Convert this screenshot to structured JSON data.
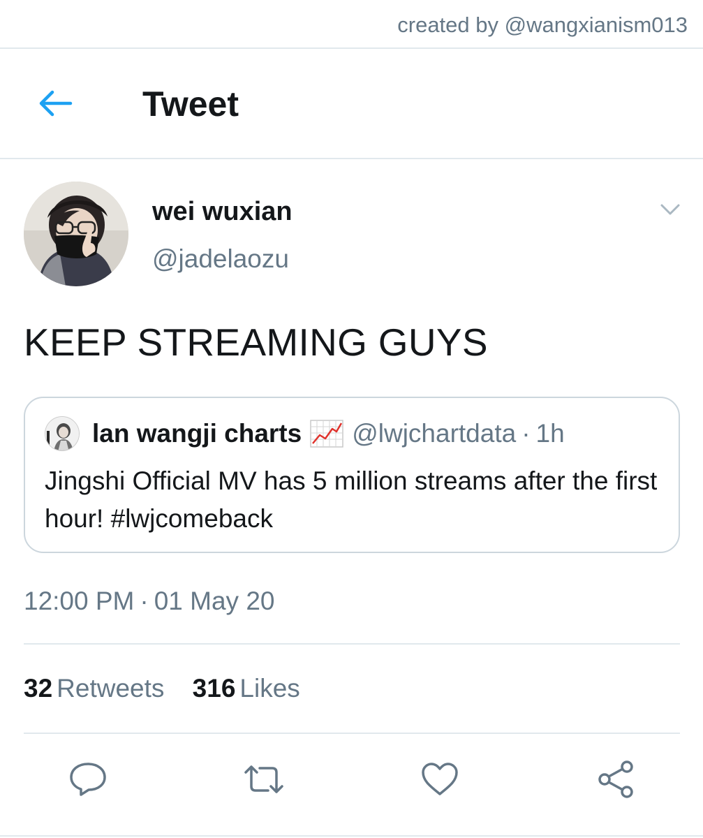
{
  "credit": "created by @wangxianism013",
  "header": {
    "back_icon": "arrow-left-icon",
    "title": "Tweet"
  },
  "tweet": {
    "display_name": "wei wuxian",
    "handle": "@jadelaozu",
    "text": "KEEP STREAMING GUYS",
    "quoted": {
      "display_name": "lan wangji charts",
      "emoji_icon": "chart-increasing-icon",
      "handle": "@lwjchartdata",
      "separator": "·",
      "time": "1h",
      "text": "Jingshi Official MV has 5 million streams after the first hour! #lwjcomeback"
    },
    "time": "12:00 PM",
    "date_separator": "·",
    "date": "01 May 20",
    "stats": {
      "retweets_count": "32",
      "retweets_label": "Retweets",
      "likes_count": "316",
      "likes_label": "Likes"
    }
  },
  "actions": [
    "reply-icon",
    "retweet-icon",
    "like-icon",
    "share-icon"
  ],
  "colors": {
    "accent": "#1da1f2",
    "secondary_text": "#657786",
    "primary_text": "#14171a",
    "divider": "#e1e8ed"
  }
}
